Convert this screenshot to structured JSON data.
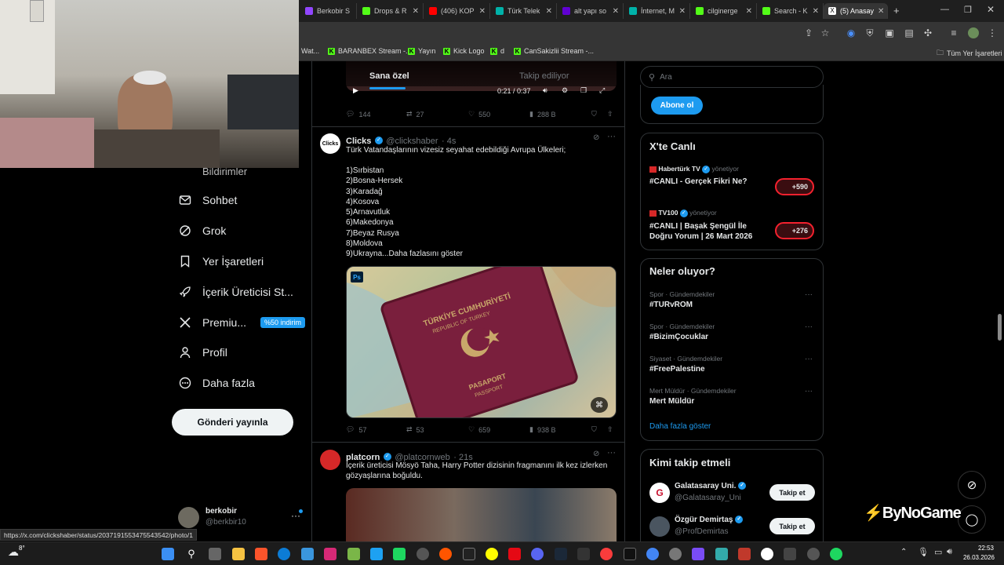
{
  "browser": {
    "tabs": [
      {
        "label": "Berkobir S",
        "color": "#9146ff"
      },
      {
        "label": "Drops & R",
        "color": "#53fc18"
      },
      {
        "label": "(406) KOP",
        "color": "#ff0000"
      },
      {
        "label": "Türk Telek",
        "color": "#00b2a9"
      },
      {
        "label": "alt yapı so",
        "color": "#6001d2"
      },
      {
        "label": "İnternet, M",
        "color": "#00b2a9"
      },
      {
        "label": "cilginerge",
        "color": "#53fc18"
      },
      {
        "label": "Search - K",
        "color": "#53fc18"
      },
      {
        "label": "(5) Anasay",
        "color": "#ffffff"
      }
    ],
    "bookmarks": [
      {
        "label": "Wat..."
      },
      {
        "label": "BARANBEX Stream -..."
      },
      {
        "label": "Yayın"
      },
      {
        "label": "Kick Logo"
      },
      {
        "label": "d"
      },
      {
        "label": "CanSakizlii Stream -..."
      }
    ],
    "all_bookmarks": "Tüm Yer İşaretleri",
    "status_url": "https://x.com/clickshaber/status/2037191553475543542/photo/1"
  },
  "feed_tabs": {
    "for_you": "Sana özel",
    "following": "Takip ediliyor"
  },
  "sidebar": {
    "partial_item": "Bildirimler",
    "items": [
      {
        "label": "Sohbet",
        "icon": "envelope-icon"
      },
      {
        "label": "Grok",
        "icon": "grok-icon"
      },
      {
        "label": "Yer İşaretleri",
        "icon": "bookmark-icon"
      },
      {
        "label": "İçerik Üreticisi St...",
        "icon": "rocket-icon"
      },
      {
        "label": "Premiu...",
        "icon": "x-logo-icon"
      },
      {
        "label": "Profil",
        "icon": "person-icon"
      },
      {
        "label": "Daha fazla",
        "icon": "more-circle-icon"
      }
    ],
    "premium_badge": "%50 indirim",
    "post_button": "Gönderi yayınla",
    "account_name": "berkobir",
    "account_handle": "@berkbir10"
  },
  "prev_tweet": {
    "replies": "144",
    "reposts": "27",
    "likes": "550",
    "views": "288 B",
    "video_time": "0:21 / 0:37"
  },
  "tweet1": {
    "name": "Clicks",
    "handle": "@clickshaber",
    "time": "· 4s",
    "avatar_text": "Clicks",
    "text": "Türk Vatandaşlarının vizesiz seyahat edebildiği Avrupa Ülkeleri;",
    "list": [
      "1)Sırbistan",
      "2)Bosna-Hersek",
      "3)Karadağ",
      "4)Kosova",
      "5)Arnavutluk",
      "6)Makedonya",
      "7)Beyaz Rusya",
      "8)Moldova",
      "9)Ukrayna..."
    ],
    "show_more": "Daha fazlasını göster",
    "passport_line1": "TÜRKİYE CUMHURİYETİ",
    "passport_line2": "REPUBLIC OF TURKEY",
    "passport_line3": "PASAPORT",
    "passport_line4": "PASSPORT",
    "ps_badge": "Ps",
    "replies": "57",
    "reposts": "53",
    "likes": "659",
    "views": "938 B"
  },
  "tweet2": {
    "name": "platcorn",
    "handle": "@platcornweb",
    "time": "· 21s",
    "text": "İçerik üreticisi Mösyö Taha, Harry Potter dizisinin fragmanını ilk kez izlerken gözyaşlarına boğuldu."
  },
  "right": {
    "search_placeholder": "Ara",
    "subscribe": "Abone ol",
    "live_title": "X'te Canlı",
    "live": [
      {
        "host": "Habertürk TV",
        "role": "yönetiyor",
        "title": "#CANLI - Gerçek Fikri Ne?",
        "count": "+590"
      },
      {
        "host": "TV100",
        "role": "yönetiyor",
        "title": "#CANLI | Başak Şengül İle Doğru Yorum | 26 Mart 2026",
        "count": "+276"
      }
    ],
    "trends_title": "Neler oluyor?",
    "trends": [
      {
        "category": "Spor · Gündemdekiler",
        "name": "#TURvROM"
      },
      {
        "category": "Spor · Gündemdekiler",
        "name": "#BizimÇocuklar"
      },
      {
        "category": "Siyaset · Gündemdekiler",
        "name": "#FreePalestine"
      },
      {
        "category": "Mert Müldür · Gündemdekiler",
        "name": "Mert Müldür"
      }
    ],
    "show_more": "Daha fazla göster",
    "who_title": "Kimi takip etmeli",
    "who": [
      {
        "name": "Galatasaray Uni.",
        "handle": "@Galatasaray_Uni",
        "button": "Takip et"
      },
      {
        "name": "Özgür Demirtaş",
        "handle": "@ProfDemirtas",
        "button": "Takip et"
      }
    ]
  },
  "watermark": "ByNoGame",
  "taskbar": {
    "weather": "8°",
    "time": "22:53",
    "date": "26.03.2026"
  }
}
